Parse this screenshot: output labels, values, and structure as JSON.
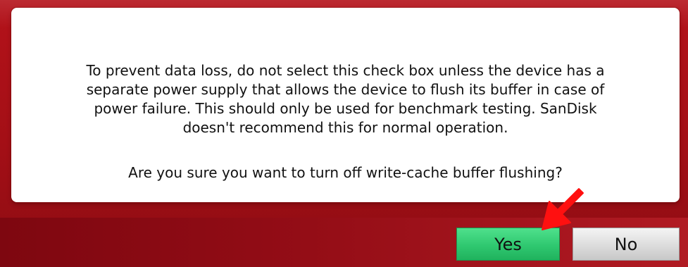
{
  "dialog": {
    "message": "To prevent data loss, do not select this check box unless the device has a\nseparate power supply that allows the device to flush its buffer in case of\npower failure. This should only be used for benchmark testing. SanDisk\ndoesn't recommend this for normal operation.",
    "question": "Are you sure you want to turn off write-cache buffer flushing?"
  },
  "buttons": {
    "yes_label": "Yes",
    "no_label": "No"
  },
  "colors": {
    "dialog_background": "#a30f16",
    "yes_button": "#2fc870",
    "no_button": "#dcdcdc",
    "annotation_arrow": "#ff0000"
  },
  "annotation": {
    "icon": "red-arrow-icon",
    "points_to": "yes-button"
  }
}
